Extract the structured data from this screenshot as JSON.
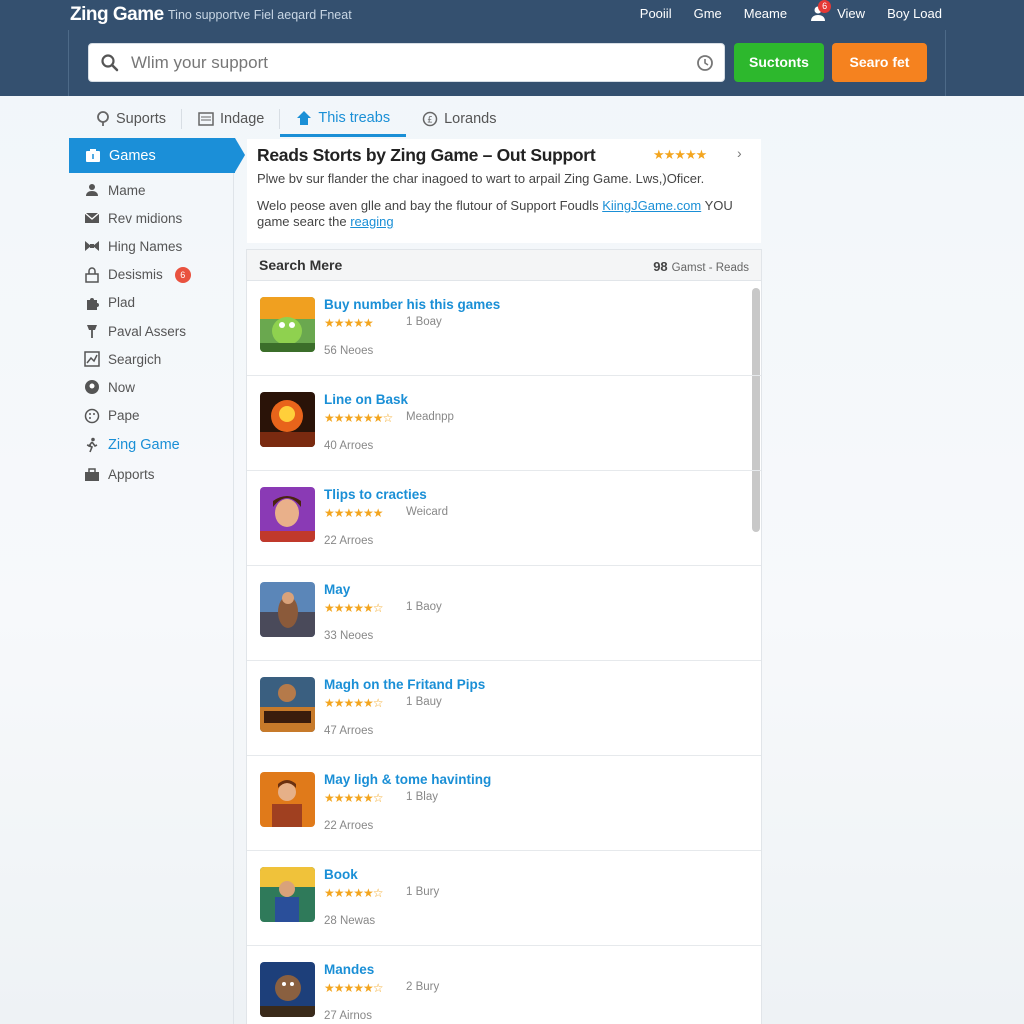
{
  "header": {
    "brand": "Zing Game",
    "tagline": "Tino supportve Fiel aeqard  Fneat",
    "nav": [
      "Pooiil",
      "Gme",
      "Meame",
      "View",
      "Boy Load"
    ],
    "notification_count": "6",
    "search_placeholder": "Wlim your support",
    "btn_primary": "Suctonts",
    "btn_secondary": "Searo fet",
    "colors": {
      "bar": "#34506f",
      "green": "#2db82d",
      "orange": "#f5821f"
    }
  },
  "tabs": [
    {
      "label": "Suports",
      "icon": "pin-icon"
    },
    {
      "label": "Indage",
      "icon": "image-icon"
    },
    {
      "label": "This treabs",
      "icon": "home-icon",
      "active": true
    },
    {
      "label": "Lorands",
      "icon": "copyright-icon"
    }
  ],
  "sidebar": {
    "active": "Games",
    "items": [
      {
        "label": "Mame",
        "icon": "user-icon"
      },
      {
        "label": "Rev midions",
        "icon": "mail-icon"
      },
      {
        "label": "Hing Names",
        "icon": "bowtie-icon"
      },
      {
        "label": "Desismis",
        "icon": "lock-icon",
        "badge": "6"
      },
      {
        "label": "Plad",
        "icon": "puzzle-icon"
      },
      {
        "label": "Paval Assers",
        "icon": "pushpin-icon"
      },
      {
        "label": "Seargich",
        "icon": "chart-icon"
      },
      {
        "label": "Now",
        "icon": "location-icon"
      },
      {
        "label": "Pape",
        "icon": "palette-icon"
      },
      {
        "label": "Zing Game",
        "icon": "runner-icon",
        "highlight": true
      },
      {
        "label": "Apports",
        "icon": "case-icon"
      }
    ]
  },
  "info": {
    "title": "Reads Storts by Zing Game – Out Support",
    "rating": "★★★★★",
    "line1": "Plwe bv sur flander the char inagoed to wart to arpail Zing Game. Lws,)Oficer.",
    "line2_pre": "Welo peose aven glle and bay the flutour of Support Foudls ",
    "line2_link": "KiingJGame.com",
    "line2_mid": " YOU game searc the ",
    "line2_link2": "reaging"
  },
  "list": {
    "title": "Search Mere",
    "meta_num": "98",
    "meta_text": "Gamst - Reads",
    "items": [
      {
        "title": "Buy number his this games",
        "stars": "★★★★★",
        "sub": "1 Boay",
        "count": "56 Neoes"
      },
      {
        "title": "Line on Bask",
        "stars": "★★★★★★☆",
        "sub": "Meadnpp",
        "count": "40 Arroes"
      },
      {
        "title": "Tlips to cracties",
        "stars": "★★★★★★",
        "sub": "Weicard",
        "count": "22 Arroes"
      },
      {
        "title": "May",
        "stars": "★★★★★☆",
        "sub": "1 Baoy",
        "count": "33 Neoes"
      },
      {
        "title": "Magh on the Fritand Pips",
        "stars": "★★★★★☆",
        "sub": "1 Bauy",
        "count": "47 Arroes"
      },
      {
        "title": "May ligh & tome havinting",
        "stars": "★★★★★☆",
        "sub": "1 Blay",
        "count": "22 Arroes"
      },
      {
        "title": "Book",
        "stars": "★★★★★☆",
        "sub": "1 Bury",
        "count": "28 Newas"
      },
      {
        "title": "Mandes",
        "stars": "★★★★★☆",
        "sub": "2 Bury",
        "count": "27 Airnos"
      }
    ]
  }
}
